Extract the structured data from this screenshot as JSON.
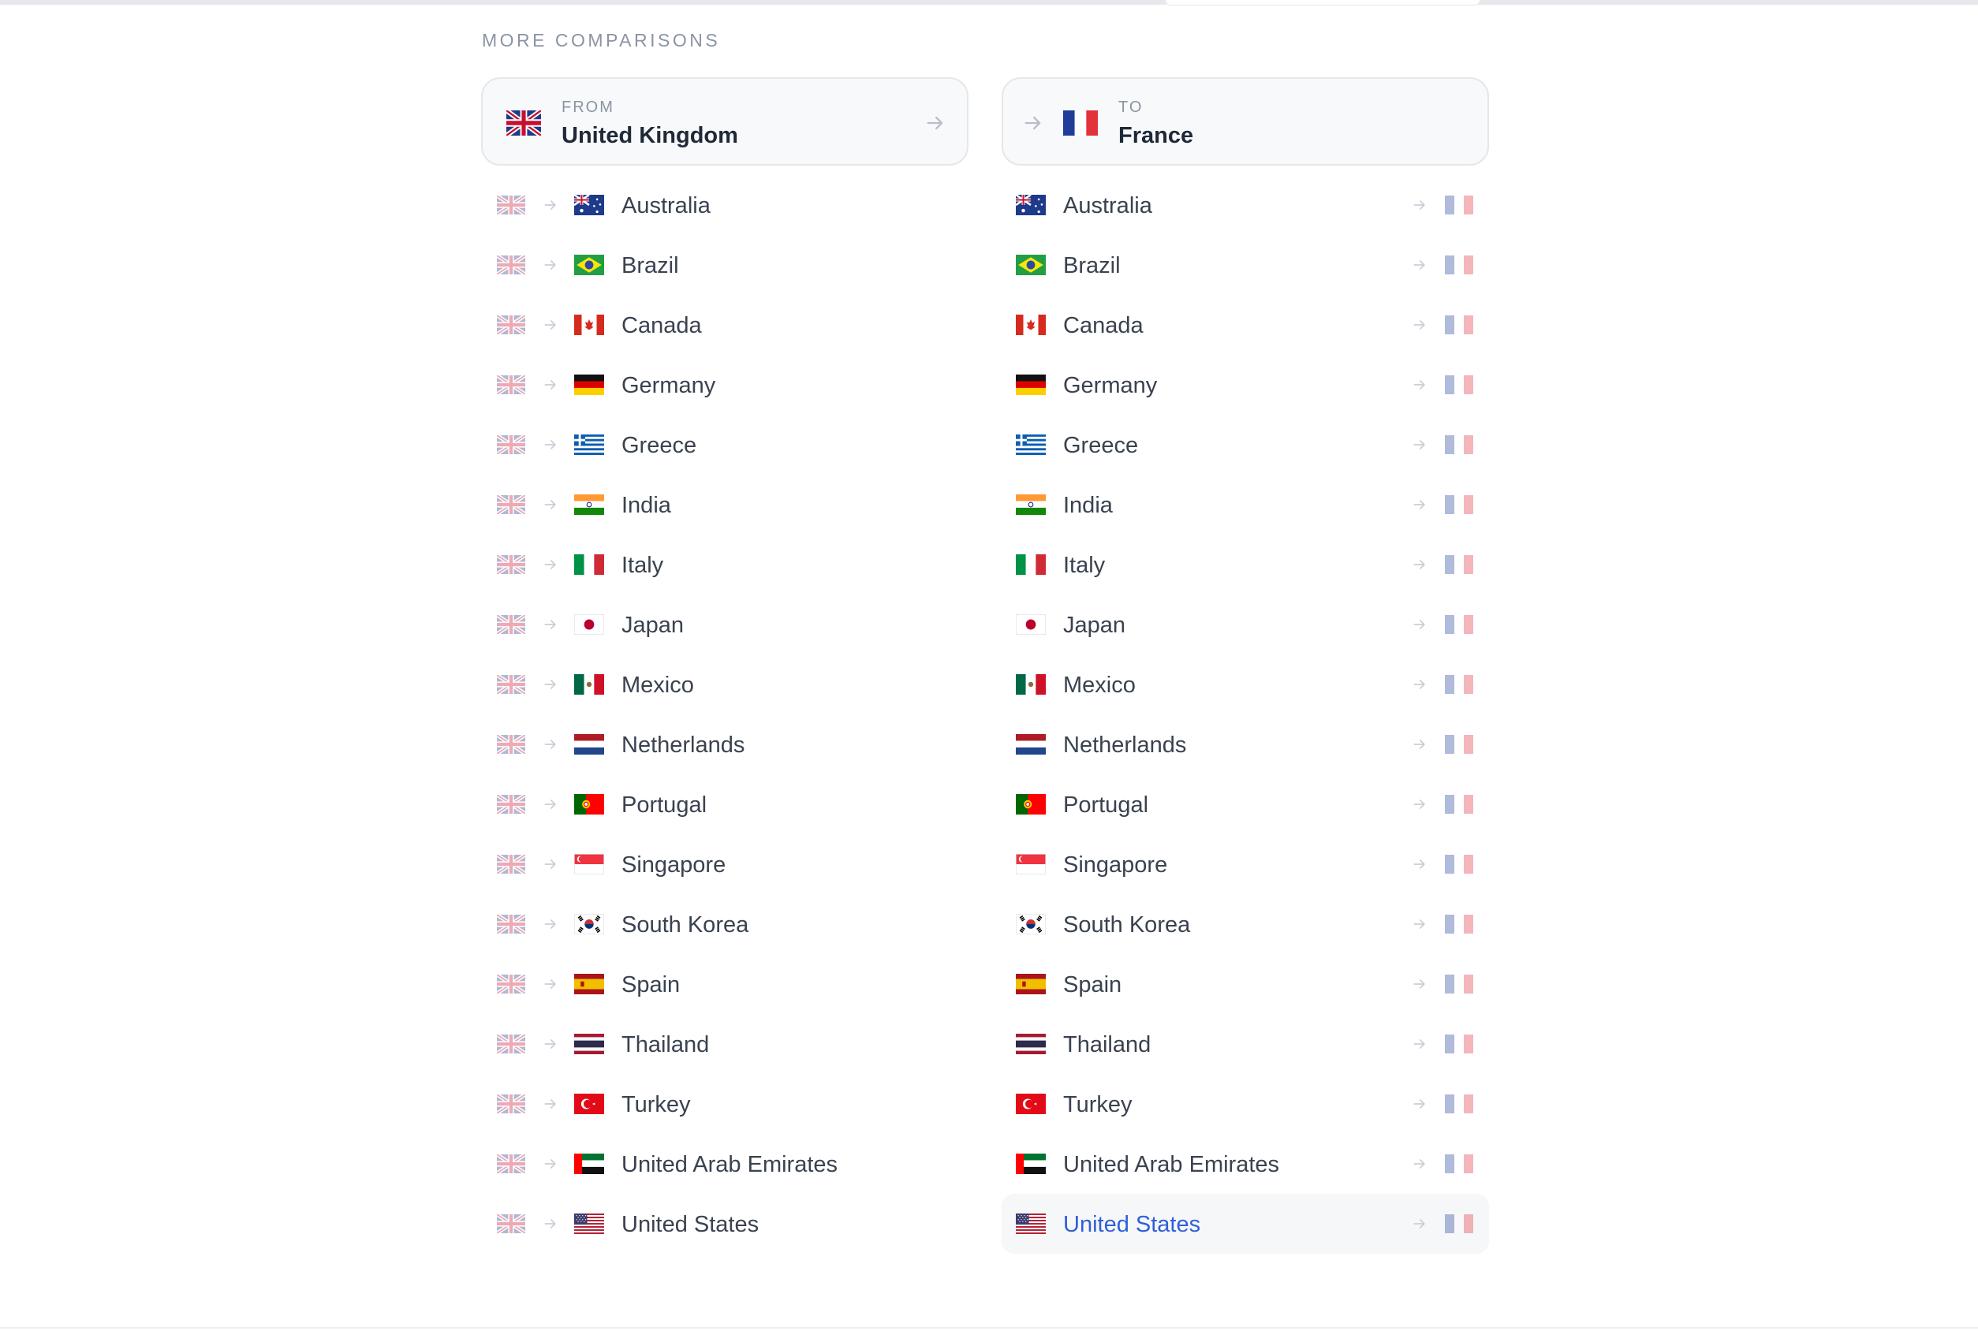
{
  "section_title": "MORE COMPARISONS",
  "from_selector": {
    "label": "FROM",
    "value": "United Kingdom",
    "flag": "gb"
  },
  "to_selector": {
    "label": "TO",
    "value": "France",
    "flag": "fr"
  },
  "from_list": [
    {
      "name": "Australia",
      "flag": "au"
    },
    {
      "name": "Brazil",
      "flag": "br"
    },
    {
      "name": "Canada",
      "flag": "ca"
    },
    {
      "name": "Germany",
      "flag": "de"
    },
    {
      "name": "Greece",
      "flag": "gr"
    },
    {
      "name": "India",
      "flag": "in"
    },
    {
      "name": "Italy",
      "flag": "it"
    },
    {
      "name": "Japan",
      "flag": "jp"
    },
    {
      "name": "Mexico",
      "flag": "mx"
    },
    {
      "name": "Netherlands",
      "flag": "nl"
    },
    {
      "name": "Portugal",
      "flag": "pt"
    },
    {
      "name": "Singapore",
      "flag": "sg"
    },
    {
      "name": "South Korea",
      "flag": "kr"
    },
    {
      "name": "Spain",
      "flag": "es"
    },
    {
      "name": "Thailand",
      "flag": "th"
    },
    {
      "name": "Turkey",
      "flag": "tr"
    },
    {
      "name": "United Arab Emirates",
      "flag": "ae"
    },
    {
      "name": "United States",
      "flag": "us"
    }
  ],
  "to_list": [
    {
      "name": "Australia",
      "flag": "au"
    },
    {
      "name": "Brazil",
      "flag": "br"
    },
    {
      "name": "Canada",
      "flag": "ca"
    },
    {
      "name": "Germany",
      "flag": "de"
    },
    {
      "name": "Greece",
      "flag": "gr"
    },
    {
      "name": "India",
      "flag": "in"
    },
    {
      "name": "Italy",
      "flag": "it"
    },
    {
      "name": "Japan",
      "flag": "jp"
    },
    {
      "name": "Mexico",
      "flag": "mx"
    },
    {
      "name": "Netherlands",
      "flag": "nl"
    },
    {
      "name": "Portugal",
      "flag": "pt"
    },
    {
      "name": "Singapore",
      "flag": "sg"
    },
    {
      "name": "South Korea",
      "flag": "kr"
    },
    {
      "name": "Spain",
      "flag": "es"
    },
    {
      "name": "Thailand",
      "flag": "th"
    },
    {
      "name": "Turkey",
      "flag": "tr"
    },
    {
      "name": "United Arab Emirates",
      "flag": "ae"
    },
    {
      "name": "United States",
      "flag": "us",
      "active": true
    }
  ],
  "colors": {
    "accent": "#2f5fd8",
    "muted": "#8a94a3",
    "text": "#3a4250"
  }
}
